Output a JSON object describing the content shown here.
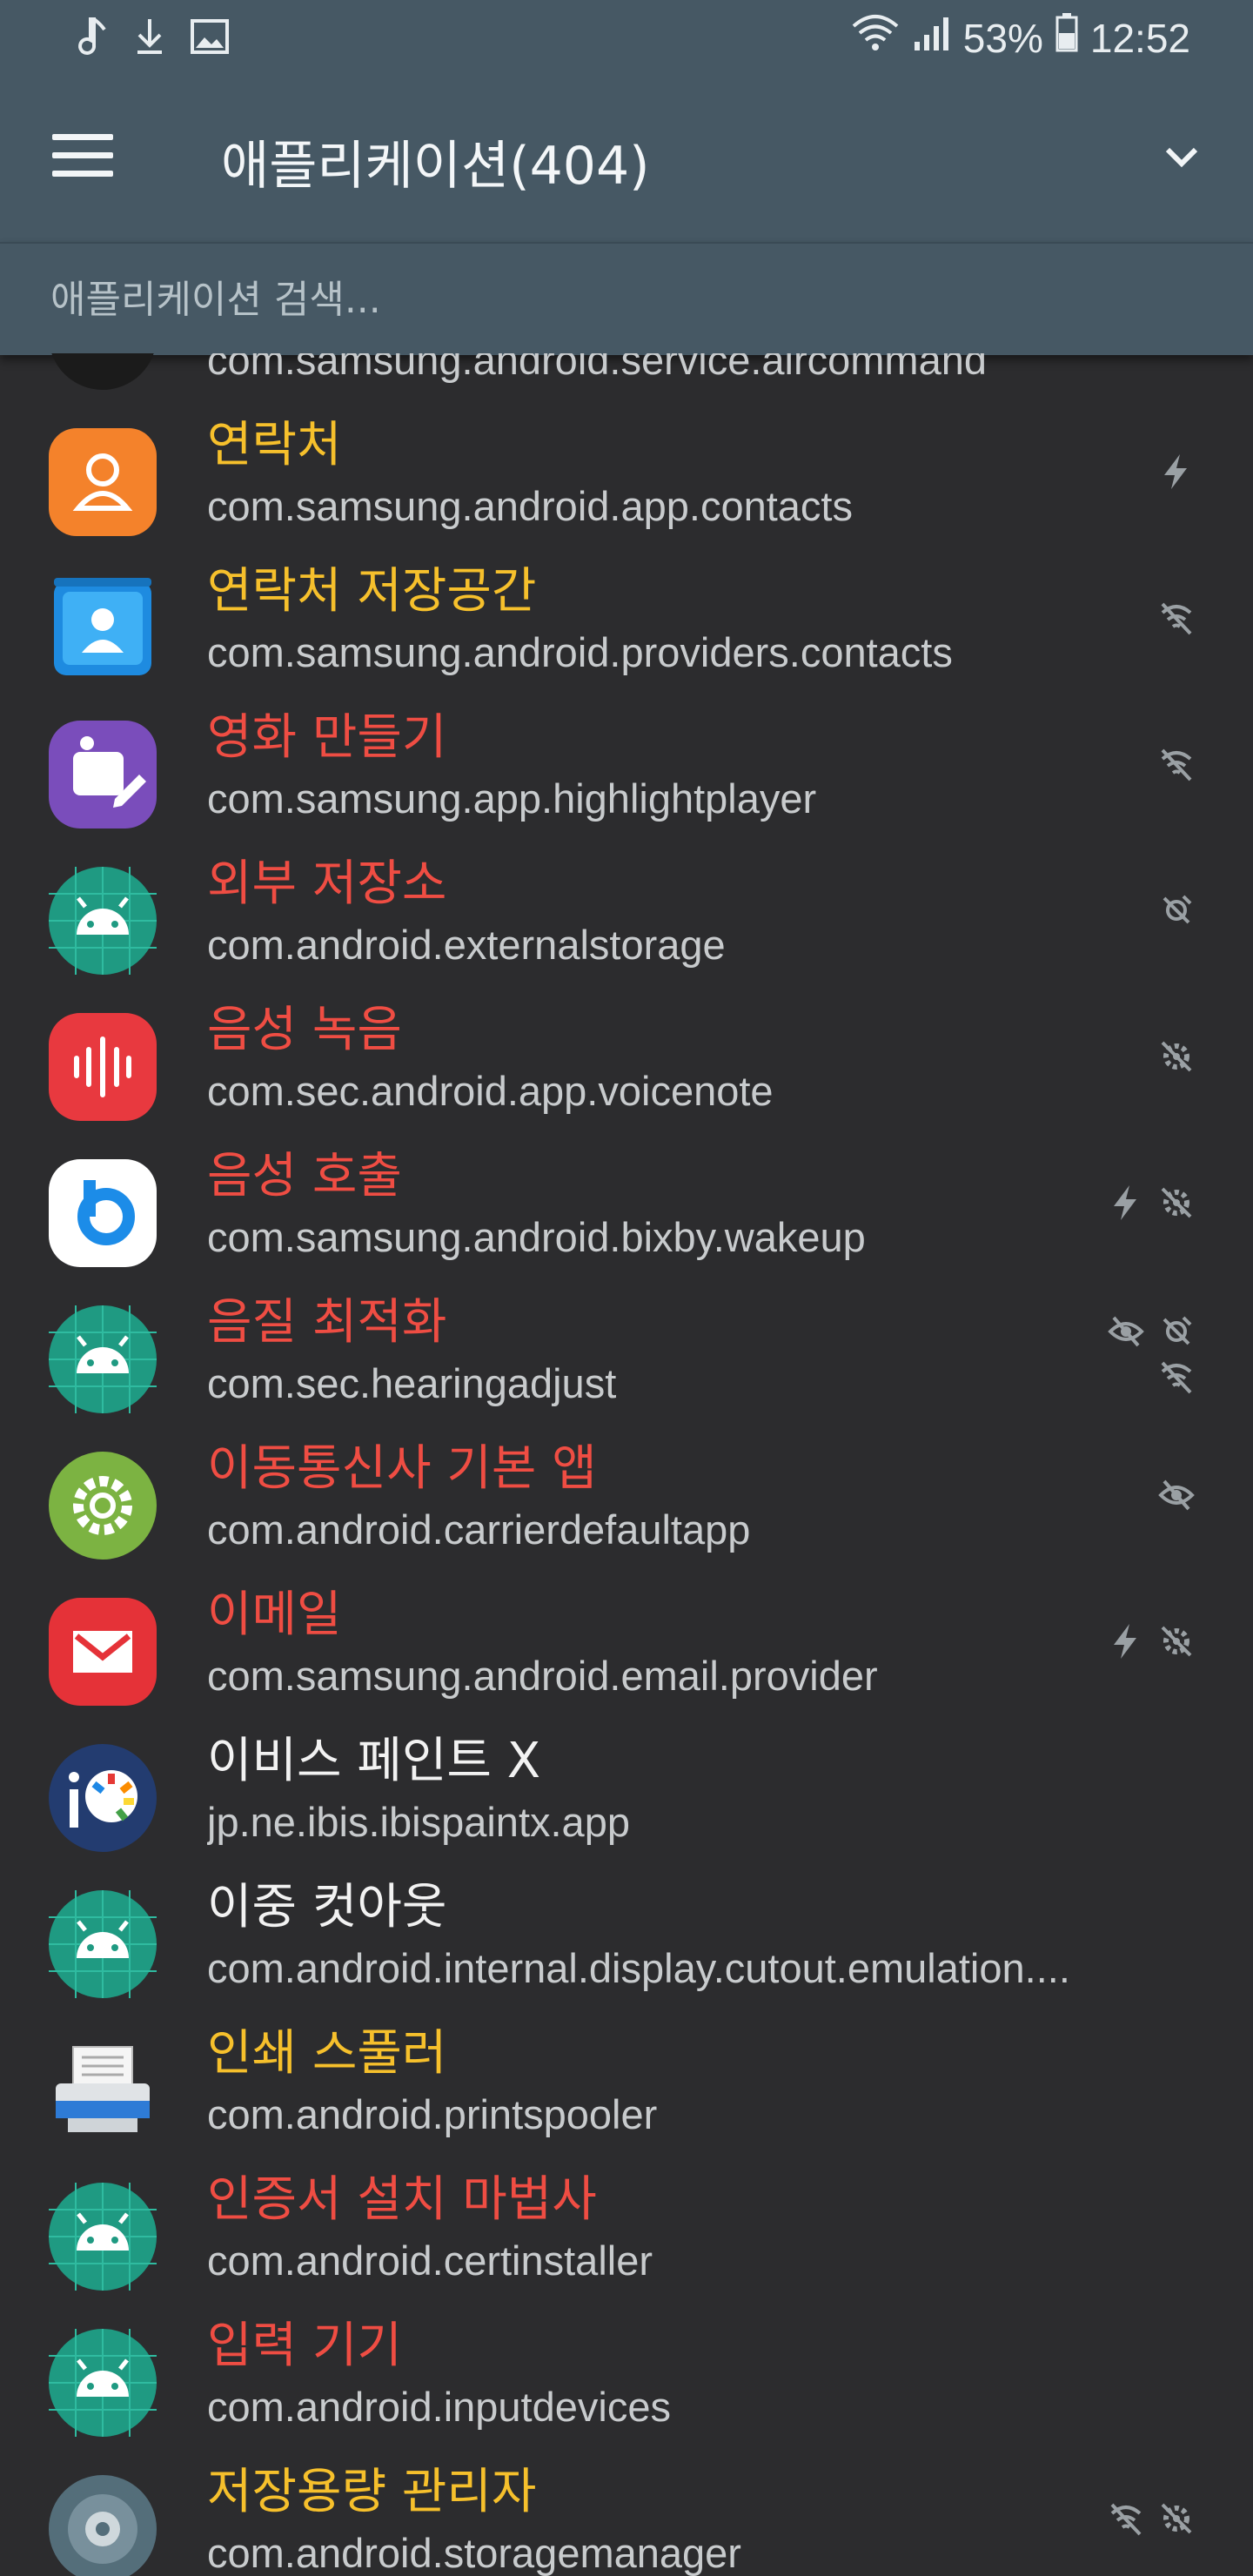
{
  "status_bar": {
    "battery": "53%",
    "time": "12:52",
    "left_icons": [
      "music-note-icon",
      "download-icon",
      "image-icon"
    ],
    "right_icons": [
      "wifi-icon",
      "signal-icon",
      "battery-icon"
    ]
  },
  "app_bar": {
    "title": "애플리케이션(404)",
    "menu_icon": "hamburger-menu-icon",
    "dropdown_icon": "chevron-down-icon"
  },
  "search": {
    "placeholder": "애플리케이션 검색..."
  },
  "colors": {
    "header": "#465864",
    "background": "#2c2c2e",
    "yellow": "#f6c02c",
    "red": "#ef4d43",
    "white": "#f2f2f2"
  },
  "apps": [
    {
      "name": "",
      "package": "com.samsung.android.service.aircommand",
      "color": "white",
      "icon": "air-command-icon",
      "flags": []
    },
    {
      "name": "연락처",
      "package": "com.samsung.android.app.contacts",
      "color": "yellow",
      "icon": "contacts-icon",
      "flags": [
        "bolt-icon"
      ]
    },
    {
      "name": "연락처 저장공간",
      "package": "com.samsung.android.providers.contacts",
      "color": "yellow",
      "icon": "contacts-storage-icon",
      "flags": [
        "no-network-icon"
      ]
    },
    {
      "name": "영화 만들기",
      "package": "com.samsung.app.highlightplayer",
      "color": "red",
      "icon": "movie-maker-icon",
      "flags": [
        "no-network-icon"
      ]
    },
    {
      "name": "외부 저장소",
      "package": "com.android.externalstorage",
      "color": "red",
      "icon": "android-icon",
      "flags": [
        "disabled-icon"
      ]
    },
    {
      "name": "음성 녹음",
      "package": "com.sec.android.app.voicenote",
      "color": "red",
      "icon": "voice-recorder-icon",
      "flags": [
        "settings-off-icon"
      ]
    },
    {
      "name": "음성 호출",
      "package": "com.samsung.android.bixby.wakeup",
      "color": "red",
      "icon": "bixby-icon",
      "flags": [
        "bolt-icon",
        "settings-off-icon"
      ]
    },
    {
      "name": "음질 최적화",
      "package": "com.sec.hearingadjust",
      "color": "red",
      "icon": "android-icon",
      "flags": [
        "hidden-icon",
        "disabled-icon",
        "no-network-icon"
      ]
    },
    {
      "name": "이동통신사 기본 앱",
      "package": "com.android.carrierdefaultapp",
      "color": "red",
      "icon": "carrier-settings-icon",
      "flags": [
        "hidden-icon"
      ]
    },
    {
      "name": "이메일",
      "package": "com.samsung.android.email.provider",
      "color": "red",
      "icon": "email-icon",
      "flags": [
        "bolt-icon",
        "settings-off-icon"
      ]
    },
    {
      "name": "이비스 페인트 X",
      "package": "jp.ne.ibis.ibispaintx.app",
      "color": "white",
      "icon": "ibis-paint-icon",
      "flags": []
    },
    {
      "name": "이중 컷아웃",
      "package": "com.android.internal.display.cutout.emulation....",
      "color": "white",
      "icon": "android-icon",
      "flags": []
    },
    {
      "name": "인쇄 스풀러",
      "package": "com.android.printspooler",
      "color": "yellow",
      "icon": "printer-icon",
      "flags": []
    },
    {
      "name": "인증서 설치 마법사",
      "package": "com.android.certinstaller",
      "color": "red",
      "icon": "android-icon",
      "flags": []
    },
    {
      "name": "입력 기기",
      "package": "com.android.inputdevices",
      "color": "red",
      "icon": "android-icon",
      "flags": []
    },
    {
      "name": "저장용량 관리자",
      "package": "com.android.storagemanager",
      "color": "yellow",
      "icon": "storage-manager-icon",
      "flags": [
        "no-network-icon",
        "settings-off-icon"
      ]
    }
  ]
}
